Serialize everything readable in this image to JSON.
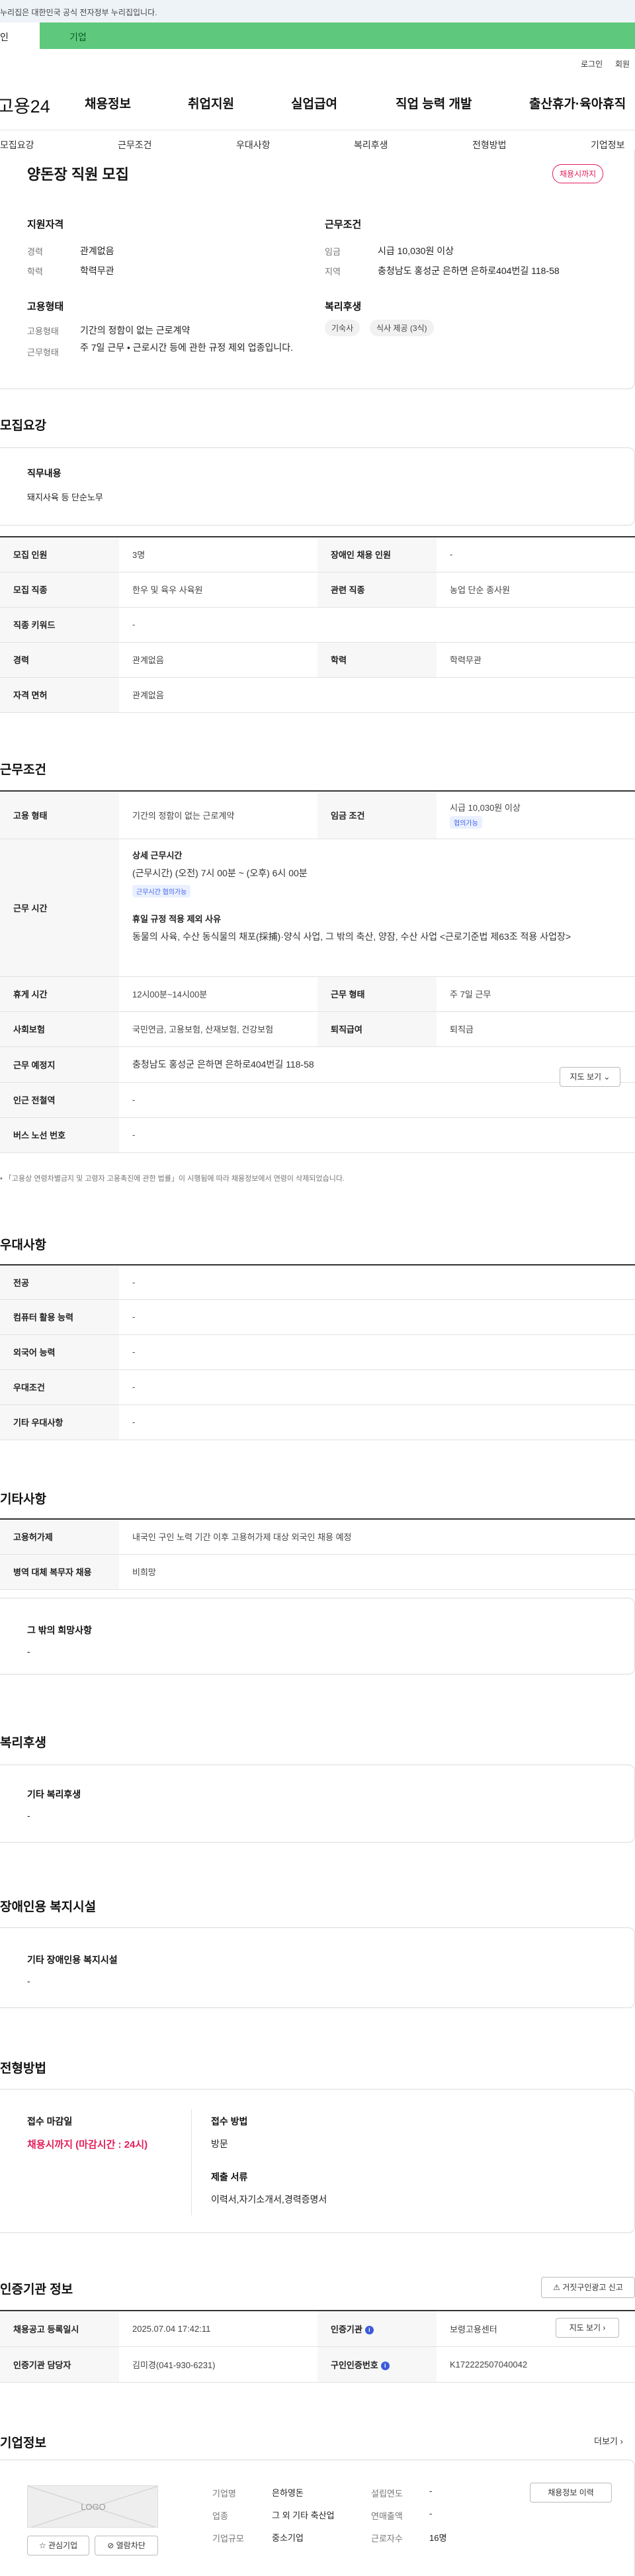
{
  "topbar": {
    "notice": "누리집은 대한민국 공식 전자정부 누리집입니다."
  },
  "tabs": {
    "personal": "인",
    "company": "기업"
  },
  "util": {
    "login": "로그인",
    "join": "회원"
  },
  "gnb": {
    "logo": "고용24",
    "items": [
      "채용정보",
      "취업지원",
      "실업급여",
      "직업 능력 개발",
      "출산휴가·육아휴직"
    ]
  },
  "subnav": {
    "items": [
      "모집요강",
      "근무조건",
      "우대사항",
      "복리후생",
      "전형방법",
      "기업정보"
    ]
  },
  "summary": {
    "title": "양돈장 직원 모집",
    "status": "채용시까지",
    "qualification": {
      "head": "지원자격",
      "career_label": "경력",
      "career": "관계없음",
      "edu_label": "학력",
      "edu": "학력무관"
    },
    "employment": {
      "head": "고용형태",
      "type_label": "고용형태",
      "type": "기간의 정함이 없는 근로계약",
      "work_label": "근무형태",
      "work": "주 7일 근무 • 근로시간 등에 관한 규정 제외 업종입니다."
    },
    "conditions": {
      "head": "근무조건",
      "wage_label": "임금",
      "wage": "시급 10,030원 이상",
      "region_label": "지역",
      "region": "충청남도 홍성군 은하면 은하로404번길 118-58"
    },
    "welfare": {
      "head": "복리후생",
      "items": [
        "기숙사",
        "식사 제공 (3식)"
      ]
    }
  },
  "recruit": {
    "title": "모집요강",
    "duty_head": "직무내용",
    "duty": "돼지사육 등 단순노무",
    "rows": {
      "headcount_label": "모집 인원",
      "headcount": "3명",
      "disabled_label": "장애인 채용 인원",
      "disabled": "-",
      "job_label": "모집 직종",
      "job": "한우 및 육우 사육원",
      "related_label": "관련 직종",
      "related": "농업 단순 종사원",
      "keyword_label": "직종 키워드",
      "keyword": "-",
      "career_label": "경력",
      "career": "관계없음",
      "edu_label": "학력",
      "edu": "학력무관",
      "license_label": "자격 면허",
      "license": "관계없음"
    }
  },
  "work": {
    "title": "근무조건",
    "type_label": "고용 형태",
    "type": "기간의 정함이 없는 근로계약",
    "wage_label": "임금 조건",
    "wage": "시급 10,030원 이상",
    "wage_badge": "협의가능",
    "hours_label": "근무 시간",
    "detail_head": "상세 근무시간",
    "detail": "(근무시간) (오전) 7시 00분 ~ (오후) 6시 00분",
    "detail_badge": "근무시간 협의가능",
    "exclude_head": "휴일 규정 적용 제외 사유",
    "exclude": "동물의 사육, 수산 동식물의 채포(採捕)·양식 사업, 그 밖의 축산, 양잠, 수산 사업 <근로기준법 제63조 적용 사업장>",
    "break_label": "휴게 시간",
    "break": "12시00분~14시00분",
    "worktype_label": "근무 형태",
    "worktype": "주 7일 근무",
    "insurance_label": "사회보험",
    "insurance": "국민연금, 고용보험, 산재보험, 건강보험",
    "severance_label": "퇴직급여",
    "severance": "퇴직금",
    "place_label": "근무 예정지",
    "place": "충청남도 홍성군 은하면 은하로404번길 118-58",
    "map_btn": "지도 보기",
    "station_label": "인근 전철역",
    "station": "-",
    "bus_label": "버스 노선 번호",
    "bus": "-",
    "note": "「고용상 연령차별금지 및 고령자 고용촉진에 관한 법률」이 시행됨에 따라 채용정보에서 연령이 삭제되었습니다."
  },
  "preference": {
    "title": "우대사항",
    "rows": [
      {
        "label": "전공",
        "value": "-"
      },
      {
        "label": "컴퓨터 활용 능력",
        "value": "-"
      },
      {
        "label": "외국어 능력",
        "value": "-"
      },
      {
        "label": "우대조건",
        "value": "-"
      },
      {
        "label": "기타 우대사항",
        "value": "-"
      }
    ]
  },
  "etc": {
    "title": "기타사항",
    "permit_label": "고용허가제",
    "permit": "내국인 구인 노력 기간 이후 고용허가제 대상 외국인 채용 예정",
    "military_label": "병역 대체 복무자 채용",
    "military": "비희망",
    "other_head": "그 밖의 희망사항",
    "other": "-"
  },
  "welfare": {
    "title": "복리후생",
    "head": "기타 복리후생",
    "value": "-"
  },
  "facility": {
    "title": "장애인용 복지시설",
    "head": "기타 장애인용 복지시설",
    "value": "-"
  },
  "selection": {
    "title": "전형방법",
    "deadline_head": "접수 마감일",
    "deadline": "채용시까지 (마감시간 : 24시)",
    "method_head": "접수 방법",
    "method": "방문",
    "docs_head": "제출 서류",
    "docs": "이력서,자기소개서,경력증명서"
  },
  "agency": {
    "title": "인증기관 정보",
    "report_btn": "거짓구인광고 신고",
    "reg_label": "채용공고 등록일시",
    "reg": "2025.07.04 17:42:11",
    "org_label": "인증기관",
    "org": "보령고용센터",
    "detail_btn": "지도 보기",
    "manager_label": "인증기관 담당자",
    "manager": "김미경(041-930-6231)",
    "num_label": "구인인증번호",
    "num": "K172222507040042"
  },
  "company": {
    "title": "기업정보",
    "more": "더보기",
    "logo": "LOGO",
    "fav_btn": "관심기업",
    "block_btn": "열람차단",
    "name_label": "기업명",
    "name": "은하영돈",
    "industry_label": "업종",
    "industry": "그 외 기타 축산업",
    "size_label": "기업규모",
    "size": "중소기업",
    "year_label": "설립연도",
    "year": "-",
    "sales_label": "연매출액",
    "sales": "-",
    "staff_label": "근로자수",
    "staff": "16명",
    "history_btn": "채용정보 이력"
  }
}
